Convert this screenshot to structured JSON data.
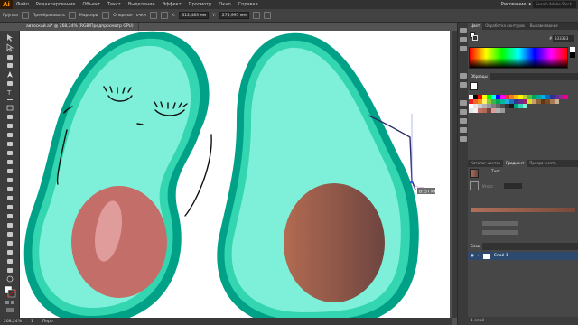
{
  "app": {
    "logo": "Ai"
  },
  "menubar": {
    "items": [
      "Файл",
      "Редактирование",
      "Объект",
      "Текст",
      "Выделение",
      "Эффект",
      "Просмотр",
      "Окно",
      "Справка"
    ]
  },
  "workspace": {
    "label": "Рисование"
  },
  "search": {
    "placeholder": "Search Adobe Stock"
  },
  "controlbar": {
    "group_label": "Группа",
    "transform_label": "Преобразовать",
    "markers_label": "Маркеры",
    "anchor_label": "Опорные точки",
    "x_value": "312,483 мм",
    "y_value": "273,997 мм"
  },
  "document": {
    "tab_title": "автоскай.ai* @ 268,24% (RGB/Предпросмотр GPU)"
  },
  "status": {
    "zoom": "268,24%",
    "page": "1",
    "tool": "Перо"
  },
  "canvas": {
    "hint_label": "В: 57 мм"
  },
  "panels": {
    "color_tabs": [
      "Цвет",
      "Обработка контуров",
      "Выравнивание"
    ],
    "hex_value": "333333",
    "swatches_tabs": [
      "Образцы"
    ],
    "gradient_tabs": [
      "Каталог цветов",
      "Градиент",
      "Прозрачность"
    ],
    "gradient_type_label": "Тип:",
    "gradient_angle_label": "Угол:",
    "layers_tabs": [
      "Слои"
    ],
    "layer_name": "Слой 1",
    "layers_count": "1 слой"
  },
  "colors": {
    "avocado_rim": "#00a187",
    "avocado_mid": "#33d6b0",
    "avocado_flesh": "#7eefd9",
    "seed_left": "#c46e69",
    "seed_right_start": "#b26b51",
    "seed_right_end": "#6e4540",
    "artboard": "#ffffff",
    "ui_dark": "#323232"
  }
}
